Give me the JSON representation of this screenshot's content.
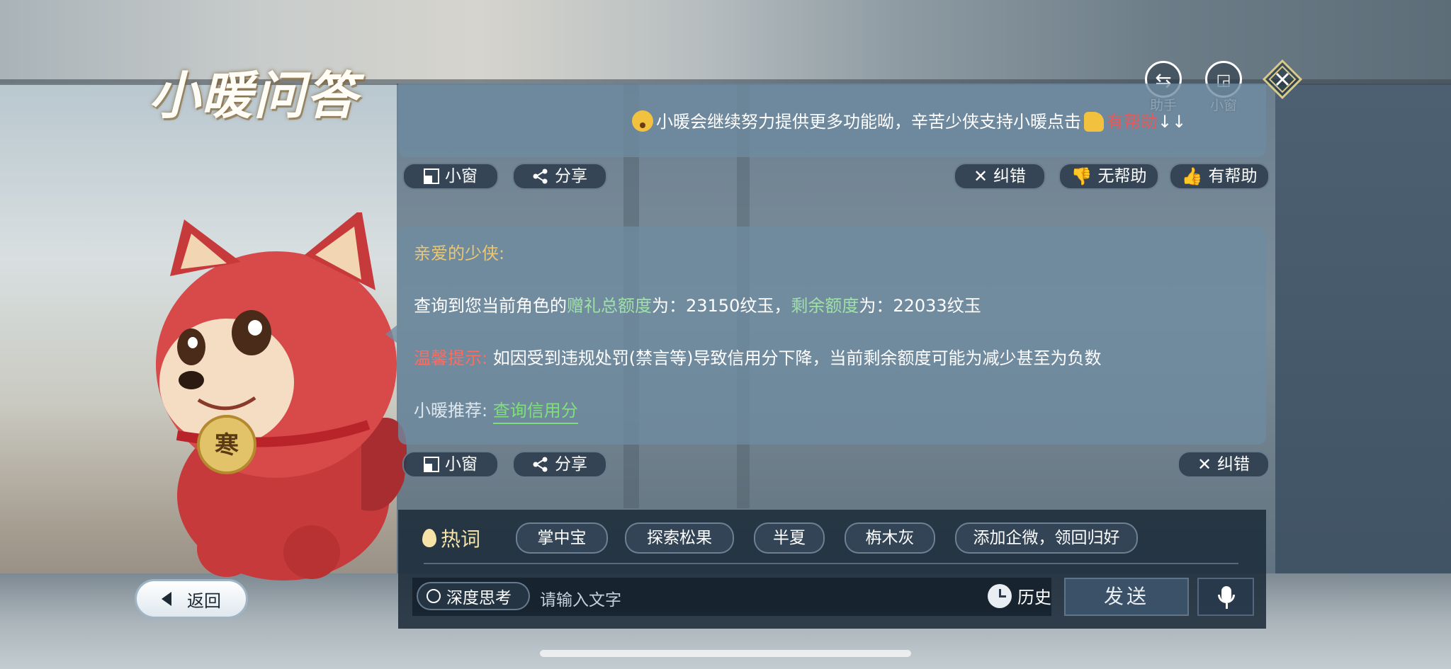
{
  "title": "小暖问答",
  "top_actions": [
    {
      "label": "助手",
      "icon": "swap-icon"
    },
    {
      "label": "小窗",
      "icon": "mini-window-icon"
    }
  ],
  "panel1": {
    "message_prefix": "小暖会继续努力提供更多功能呦，辛苦少侠支持小暖点击",
    "message_link": "有帮助",
    "message_suffix": "↓↓"
  },
  "panel1_actions": {
    "mini_window": "小窗",
    "share": "分享",
    "correct": "纠错",
    "not_helpful": "无帮助",
    "helpful": "有帮助"
  },
  "panel2": {
    "greeting": "亲爱的少侠:",
    "line1_prefix": "查询到您当前角色的",
    "line1_term1": "赠礼总额度",
    "line1_mid1": "为：23150纹玉，",
    "line1_term2": "剩余额度",
    "line1_mid2": "为：22033纹玉",
    "tip_label": "温馨提示:",
    "tip_text": "如因受到违规处罚(禁言等)导致信用分下降，当前剩余额度可能为减少甚至为负数",
    "recommend_label": "小暖推荐:",
    "recommend_link": "查询信用分"
  },
  "panel2_actions": {
    "mini_window": "小窗",
    "share": "分享",
    "correct": "纠错"
  },
  "hot": {
    "label": "热词",
    "chips": [
      "掌中宝",
      "探索松果",
      "半夏",
      "栴木灰",
      "添加企微，领回归好"
    ]
  },
  "input": {
    "think_label": "深度思考",
    "placeholder": "请输入文字",
    "history_label": "历史",
    "send_label": "发送"
  },
  "back_label": "返回",
  "colors": {
    "panel": "#6e8aa0",
    "accent_gold": "#e8c777",
    "accent_green": "#7fe07a",
    "accent_red": "#ff6b5e"
  }
}
